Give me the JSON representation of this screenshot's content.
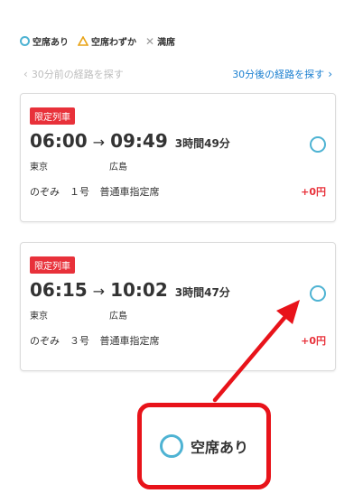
{
  "legend": {
    "available": "空席あり",
    "few": "空席わずか",
    "full": "満席"
  },
  "nav": {
    "prev_label": "30分前の経路を探す",
    "next_label": "30分後の経路を探す"
  },
  "results": [
    {
      "badge": "限定列車",
      "depart": "06:00",
      "arrive": "09:49",
      "duration": "3時間49分",
      "from": "東京",
      "to": "広島",
      "train": "のぞみ　１号",
      "seat_class": "普通車指定席",
      "price": "+0円"
    },
    {
      "badge": "限定列車",
      "depart": "06:15",
      "arrive": "10:02",
      "duration": "3時間47分",
      "from": "東京",
      "to": "広島",
      "train": "のぞみ　３号",
      "seat_class": "普通車指定席",
      "price": "+0円"
    }
  ],
  "callout": {
    "label": "空席あり"
  },
  "colors": {
    "accent": "#4eb3d3",
    "badge": "#e8313a",
    "link": "#1a7fd0",
    "callout": "#e8131a",
    "triangle": "#e8a316"
  }
}
